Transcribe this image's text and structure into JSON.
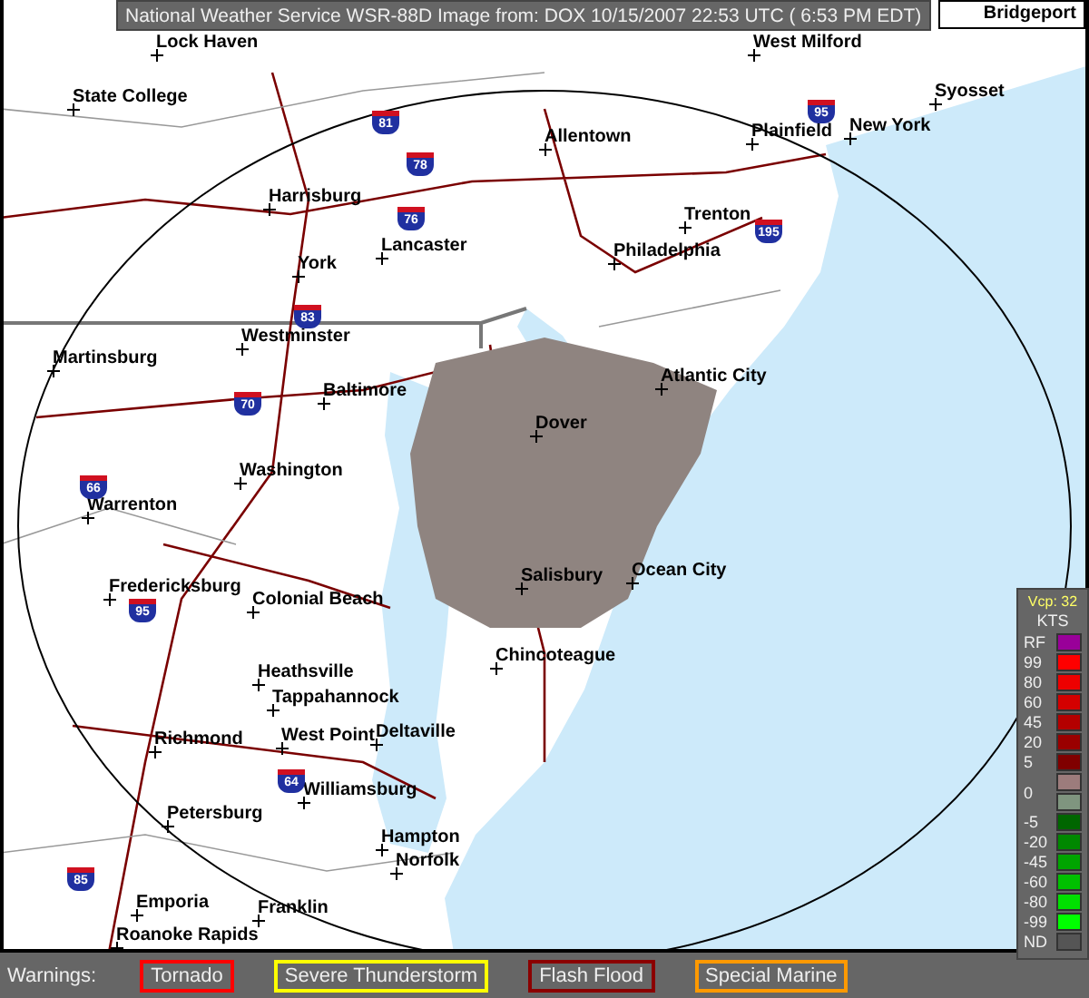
{
  "header": {
    "title": "National Weather Service WSR-88D Image from:  DOX 10/15/2007  22:53 UTC ( 6:53 PM EDT)"
  },
  "map": {
    "corner_label": "Bridgeport",
    "cities": [
      {
        "name": "Lock Haven"
      },
      {
        "name": "West Milford"
      },
      {
        "name": "State College"
      },
      {
        "name": "Allentown"
      },
      {
        "name": "Plainfield"
      },
      {
        "name": "New York"
      },
      {
        "name": "Syosset"
      },
      {
        "name": "Harrisburg"
      },
      {
        "name": "Lancaster"
      },
      {
        "name": "York"
      },
      {
        "name": "Trenton"
      },
      {
        "name": "Philadelphia"
      },
      {
        "name": "Westminster"
      },
      {
        "name": "Martinsburg"
      },
      {
        "name": "Atlantic City"
      },
      {
        "name": "Baltimore"
      },
      {
        "name": "Dover"
      },
      {
        "name": "Washington"
      },
      {
        "name": "Warrenton"
      },
      {
        "name": "Fredericksburg"
      },
      {
        "name": "Colonial Beach"
      },
      {
        "name": "Salisbury"
      },
      {
        "name": "Ocean City"
      },
      {
        "name": "Chincoteague"
      },
      {
        "name": "Heathsville"
      },
      {
        "name": "Tappahannock"
      },
      {
        "name": "Richmond"
      },
      {
        "name": "West Point"
      },
      {
        "name": "Deltaville"
      },
      {
        "name": "Williamsburg"
      },
      {
        "name": "Petersburg"
      },
      {
        "name": "Hampton"
      },
      {
        "name": "Norfolk"
      },
      {
        "name": "Emporia"
      },
      {
        "name": "Franklin"
      },
      {
        "name": "Roanoke Rapids"
      }
    ],
    "shields": [
      {
        "label": "81"
      },
      {
        "label": "78"
      },
      {
        "label": "76"
      },
      {
        "label": "83"
      },
      {
        "label": "70"
      },
      {
        "label": "95"
      },
      {
        "label": "195"
      },
      {
        "label": "66"
      },
      {
        "label": "95"
      },
      {
        "label": "64"
      },
      {
        "label": "85"
      }
    ]
  },
  "legend": {
    "mode": "Vcp: 32",
    "units": "KTS",
    "entries": [
      {
        "label": "RF",
        "swatches": [
          {
            "color": "#990099"
          }
        ]
      },
      {
        "label": "99",
        "swatches": [
          {
            "color": "#ff0000"
          }
        ]
      },
      {
        "label": "80",
        "swatches": [
          {
            "color": "#ee0000"
          }
        ]
      },
      {
        "label": "60",
        "swatches": [
          {
            "color": "#d40000"
          }
        ]
      },
      {
        "label": "45",
        "swatches": [
          {
            "color": "#b40000"
          }
        ]
      },
      {
        "label": "20",
        "swatches": [
          {
            "color": "#9a0000"
          }
        ]
      },
      {
        "label": "5",
        "swatches": [
          {
            "color": "#800000"
          }
        ]
      },
      {
        "label": "0",
        "swatches": [
          {
            "color": "#9c7c7c"
          },
          {
            "color": "#7f957f"
          }
        ]
      },
      {
        "label": "-5",
        "swatches": [
          {
            "color": "#006600"
          }
        ]
      },
      {
        "label": "-20",
        "swatches": [
          {
            "color": "#008800"
          }
        ]
      },
      {
        "label": "-45",
        "swatches": [
          {
            "color": "#00a400"
          }
        ]
      },
      {
        "label": "-60",
        "swatches": [
          {
            "color": "#00c000"
          }
        ]
      },
      {
        "label": "-80",
        "swatches": [
          {
            "color": "#00e000"
          }
        ]
      },
      {
        "label": "-99",
        "swatches": [
          {
            "color": "#00ff00"
          }
        ]
      },
      {
        "label": "ND",
        "swatches": [
          {
            "color": "#555555"
          }
        ]
      }
    ]
  },
  "warnings": {
    "label": "Warnings:",
    "items": [
      {
        "label": "Tornado",
        "color": "#ff0000"
      },
      {
        "label": "Severe Thunderstorm",
        "color": "#ffff00"
      },
      {
        "label": "Flash Flood",
        "color": "#8b0000"
      },
      {
        "label": "Special Marine",
        "color": "#ff9900"
      }
    ]
  }
}
